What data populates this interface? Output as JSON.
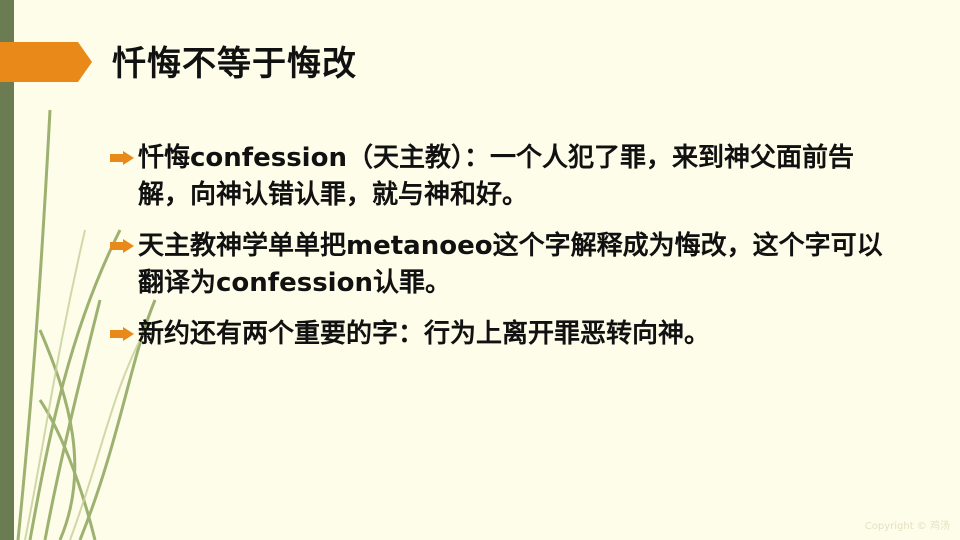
{
  "slide": {
    "title": "忏悔不等于悔改",
    "bullets": [
      {
        "text": "忏悔confession（天主教）：一个人犯了罪，来到神父面前告解，向神认错认罪，就与神和好。"
      },
      {
        "text": "天主教神学单单把metanoeo这个字解释成为悔改，这个字可以翻译为confession认罪。"
      },
      {
        "text": "新约还有两个重要的字：行为上离开罪恶转向神。"
      }
    ],
    "watermark": "Copyright © 鸡汤"
  },
  "colors": {
    "background": "#fdfde9",
    "side_bar": "#6b7b52",
    "accent_orange": "#e8891a",
    "leaf_green": "#8da45b"
  },
  "icons": {
    "bullet": "right-arrow-bullet-icon",
    "title_marker": "chevron-arrow-icon"
  }
}
